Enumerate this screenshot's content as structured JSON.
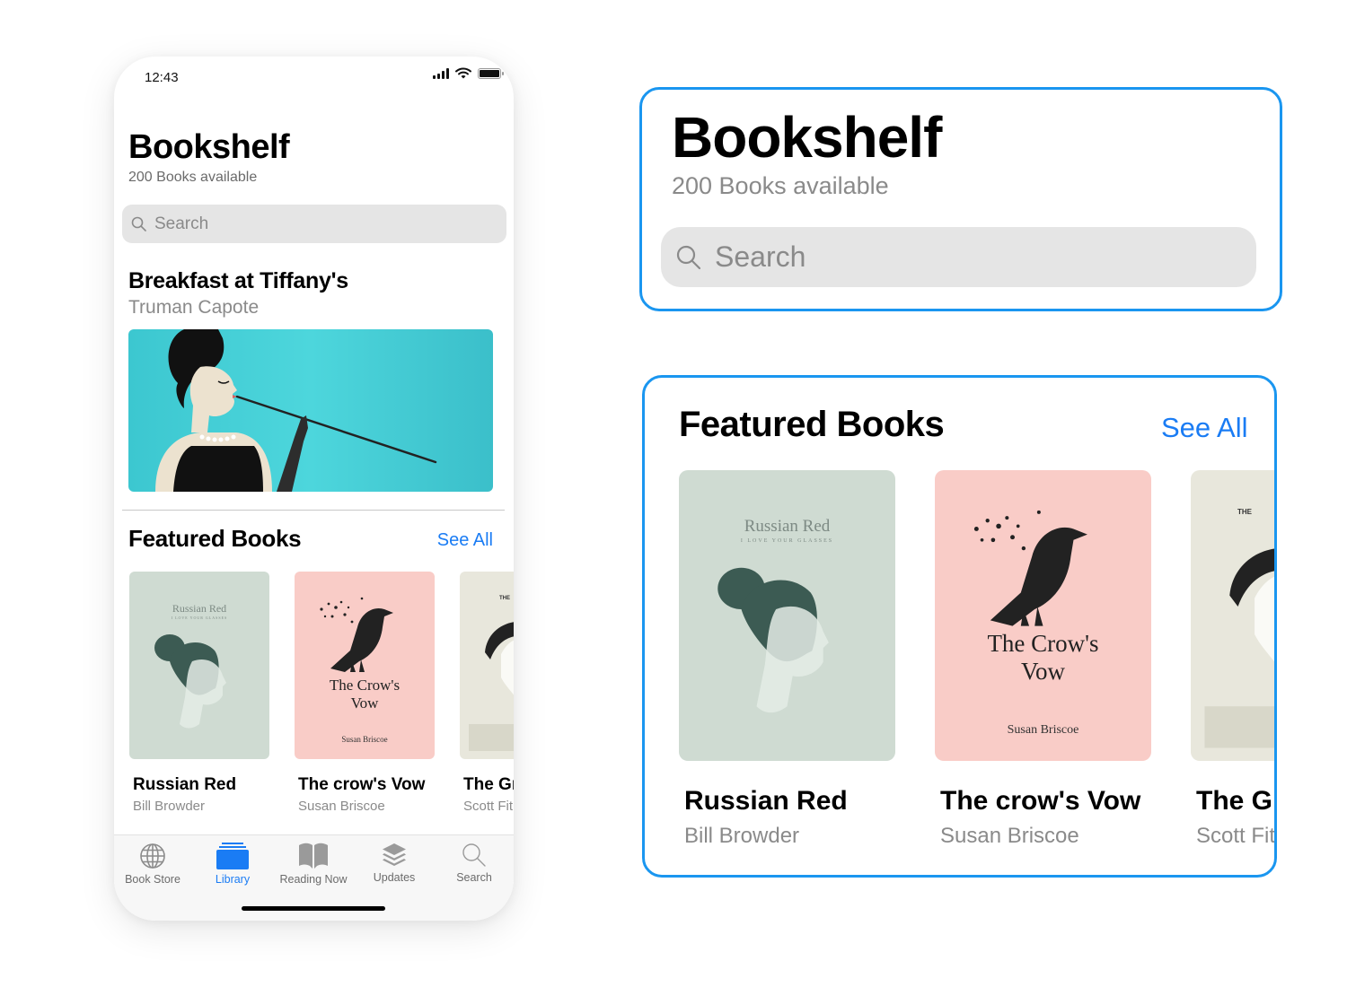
{
  "status_bar": {
    "time": "12:43"
  },
  "header": {
    "title": "Bookshelf",
    "subtitle": "200 Books available",
    "search_placeholder": "Search"
  },
  "hero": {
    "title": "Breakfast at Tiffany's",
    "author": "Truman Capote",
    "image_bg": "#44ccd6"
  },
  "featured": {
    "title": "Featured Books",
    "see_all_label": "See All",
    "books": [
      {
        "title": "Russian Red",
        "author": "Bill Browder",
        "cover_title": "Russian Red",
        "cover_subtitle": "I LOVE YOUR GLASSES",
        "cover_color": "#cfdbd2"
      },
      {
        "title": "The crow's Vow",
        "author": "Susan Briscoe",
        "cover_title": "The Crow's Vow",
        "cover_title_line1": "The Crow's",
        "cover_title_line2": "Vow",
        "cover_author": "Susan Briscoe",
        "cover_color": "#f9ccc7"
      },
      {
        "title": "The Gr",
        "author": "Scott Fit",
        "cover_title": "THE",
        "cover_color": "#e8e7dc"
      }
    ]
  },
  "tab_bar": {
    "tabs": [
      {
        "label": "Book Store",
        "icon": "globe-icon",
        "active": false
      },
      {
        "label": "Library",
        "icon": "library-icon",
        "active": true
      },
      {
        "label": "Reading Now",
        "icon": "open-book-icon",
        "active": false
      },
      {
        "label": "Updates",
        "icon": "layers-icon",
        "active": false
      },
      {
        "label": "Search",
        "icon": "search-icon",
        "active": false
      }
    ]
  },
  "colors": {
    "accent": "#1a7cf4",
    "highlight_border": "#1a96f0",
    "search_bg": "#e5e5e5",
    "secondary_text": "#8a8a8a"
  }
}
